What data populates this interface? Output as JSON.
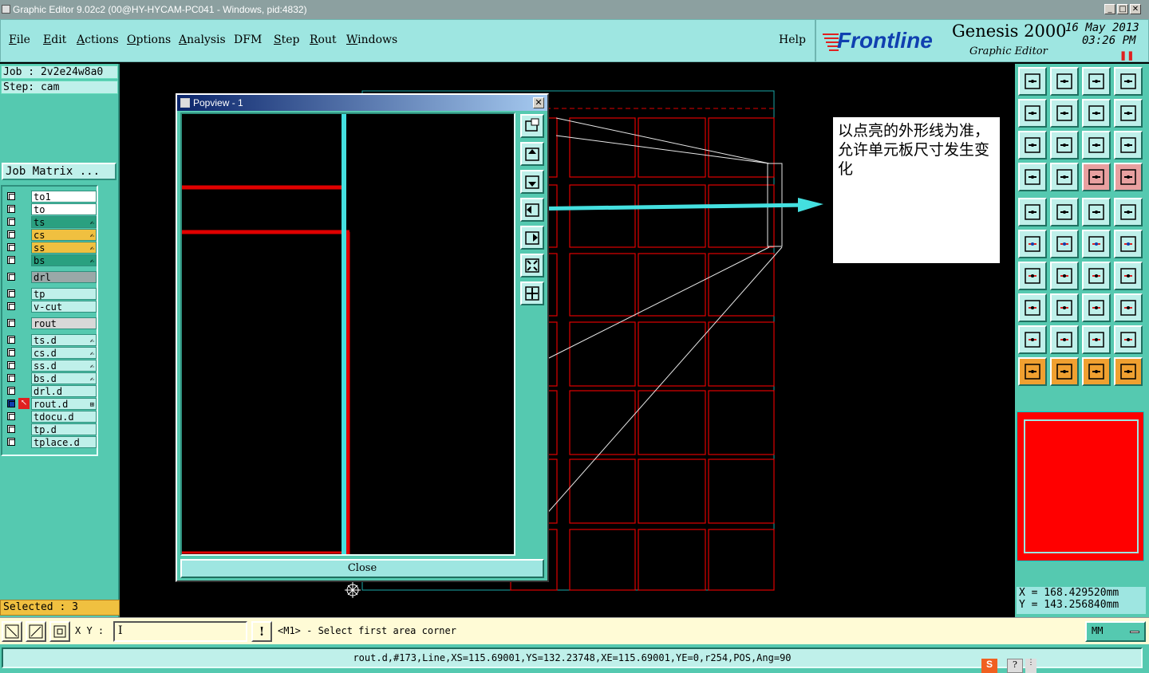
{
  "window": {
    "title": "Graphic Editor 9.02c2 (00@HY-HYCAM-PC041 - Windows, pid:4832)"
  },
  "menu": [
    {
      "label": "File",
      "u": "F",
      "rest": "ile"
    },
    {
      "label": "Edit",
      "u": "E",
      "rest": "dit"
    },
    {
      "label": "Actions",
      "u": "A",
      "rest": "ctions"
    },
    {
      "label": "Options",
      "u": "O",
      "rest": "ptions"
    },
    {
      "label": "Analysis",
      "u": "A",
      "rest": "nalysis"
    },
    {
      "label": "DFM",
      "u": "",
      "rest": "DFM"
    },
    {
      "label": "Step",
      "u": "S",
      "rest": "tep"
    },
    {
      "label": "Rout",
      "u": "R",
      "rest": "out"
    },
    {
      "label": "Windows",
      "u": "W",
      "rest": "indows"
    }
  ],
  "help": "Help",
  "brand": {
    "logo": "Frontline",
    "product": "Genesis 2000",
    "subtitle": "Graphic Editor",
    "date": "16 May 2013",
    "time": "03:26 PM"
  },
  "job": {
    "job": "Job : 2v2e24w8a0",
    "step": "Step: cam",
    "matrix_button": "Job Matrix ..."
  },
  "layers": [
    {
      "name": "to1",
      "color": "#ffffff",
      "mark": ""
    },
    {
      "name": "to",
      "color": "#ffffff",
      "mark": ""
    },
    {
      "name": "ts",
      "color": "#2aa080",
      "mark": "✍"
    },
    {
      "name": "cs",
      "color": "#f0c040",
      "mark": "✍"
    },
    {
      "name": "ss",
      "color": "#f0c040",
      "mark": "✍"
    },
    {
      "name": "bs",
      "color": "#2aa080",
      "mark": "✍"
    },
    {
      "name": "drl",
      "color": "#9aa8a8",
      "mark": ""
    },
    {
      "name": "tp",
      "color": "#bff0ea",
      "mark": ""
    },
    {
      "name": "v-cut",
      "color": "#bff0ea",
      "mark": ""
    },
    {
      "name": "rout",
      "color": "#d8d8d8",
      "mark": ""
    },
    {
      "name": "ts.d",
      "color": "#bff0ea",
      "mark": "✍"
    },
    {
      "name": "cs.d",
      "color": "#bff0ea",
      "mark": "✍"
    },
    {
      "name": "ss.d",
      "color": "#bff0ea",
      "mark": "✍"
    },
    {
      "name": "bs.d",
      "color": "#bff0ea",
      "mark": "✍"
    },
    {
      "name": "drl.d",
      "color": "#bff0ea",
      "mark": ""
    },
    {
      "name": "rout.d",
      "color": "#bff0ea",
      "mark": "⊞"
    },
    {
      "name": "tdocu.d",
      "color": "#bff0ea",
      "mark": ""
    },
    {
      "name": "tp.d",
      "color": "#bff0ea",
      "mark": ""
    },
    {
      "name": "tplace.d",
      "color": "#bff0ea",
      "mark": ""
    }
  ],
  "selected": "Selected : 3",
  "popup": {
    "title": "Popview - 1",
    "close": "Close"
  },
  "annotation": "以点亮的外形线为准，允许单元板尺寸发生变化",
  "coords": {
    "x": "X  =  168.429520mm",
    "y": "Y  =  143.256840mm"
  },
  "command": {
    "xy_label": "X Y :",
    "xy_value": "",
    "prompt": "<M1> - Select first area corner",
    "units": "MM"
  },
  "status": "rout.d,#173,Line,XS=115.69001,YS=132.23748,XE=115.69001,YE=0,r254,POS,Ang=90"
}
